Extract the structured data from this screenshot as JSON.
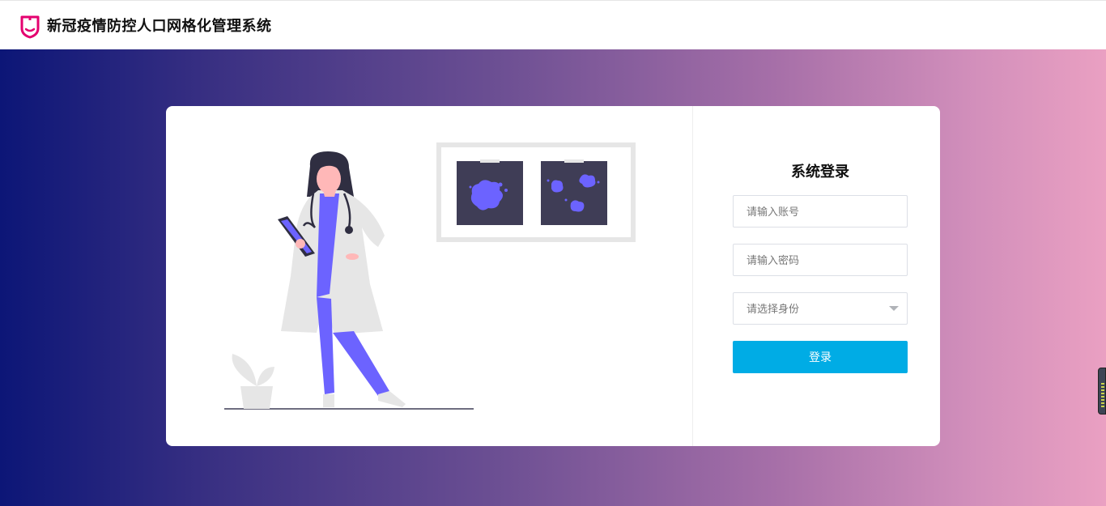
{
  "header": {
    "title": "新冠疫情防控人口网格化管理系统",
    "logo_icon": "shield-icon",
    "logo_color": "#e4006f"
  },
  "background": {
    "gradient_start": "#0c1677",
    "gradient_end": "#eaa0c2"
  },
  "illustration": {
    "subject": "doctor-with-xray-panels",
    "accent_color": "#6c63ff"
  },
  "login": {
    "title": "系统登录",
    "account_placeholder": "请输入账号",
    "password_placeholder": "请输入密码",
    "role_placeholder": "请选择身份",
    "submit_label": "登录",
    "submit_color": "#00ace5"
  }
}
